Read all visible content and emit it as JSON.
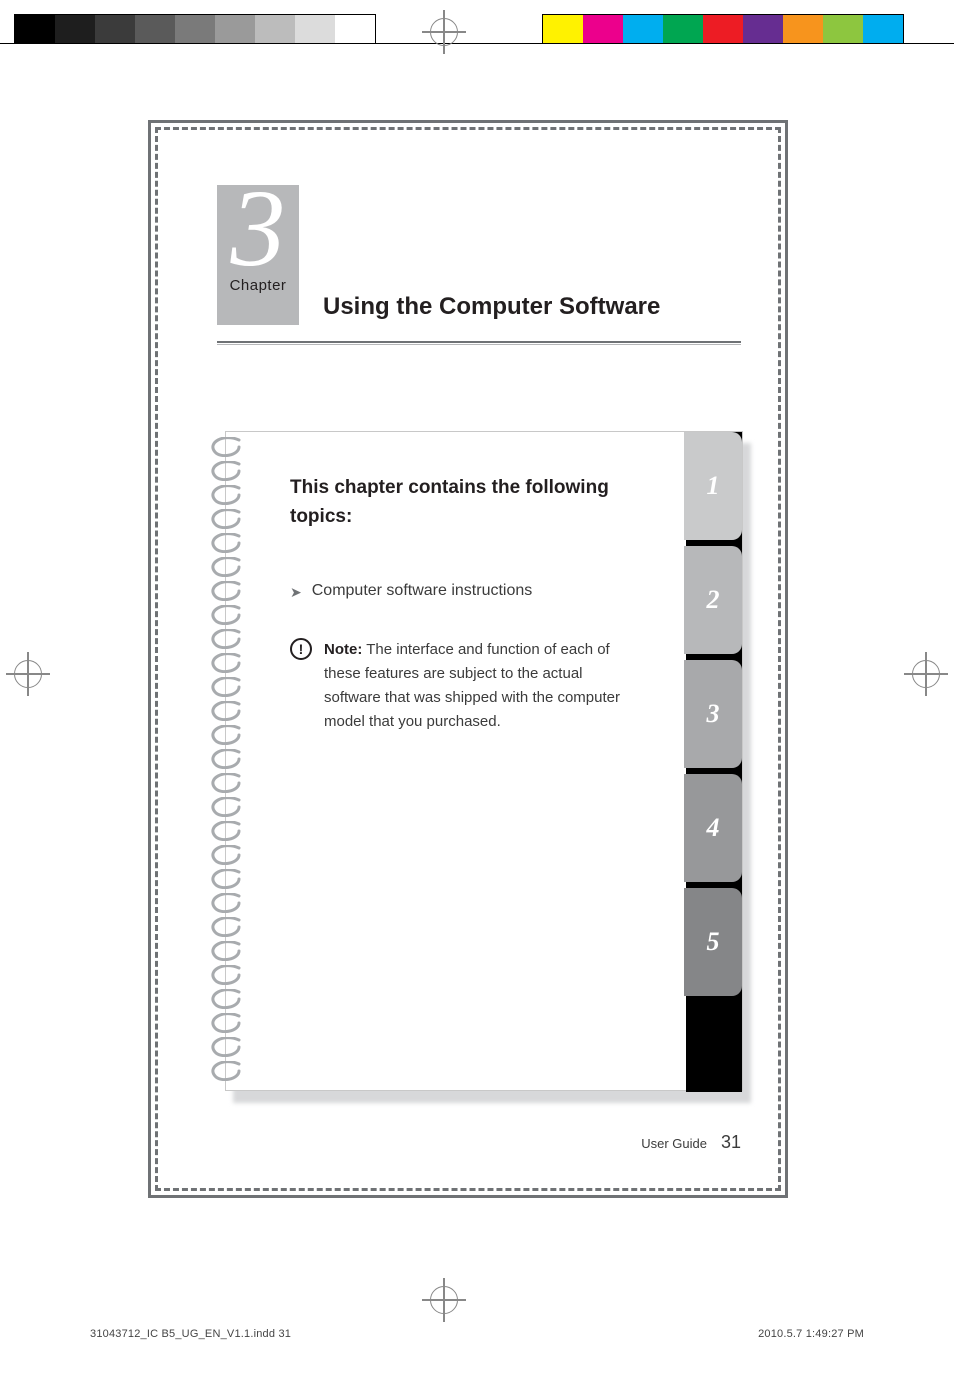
{
  "registration": {
    "left_swatches": [
      "#000000",
      "#1e1e1e",
      "#3b3b3b",
      "#5a5a5a",
      "#7a7a7a",
      "#9a9a9a",
      "#bcbcbc",
      "#dcdcdc",
      "#ffffff"
    ],
    "right_swatches": [
      "#fff200",
      "#ec008c",
      "#00aeef",
      "#00a651",
      "#ed1c24",
      "#662d91",
      "#f7941d",
      "#8dc63f",
      "#00adef"
    ]
  },
  "chapter": {
    "number": "3",
    "label": "Chapter",
    "title": "Using the Computer Software"
  },
  "topics": {
    "heading": "This chapter contains the following topics:",
    "items": [
      "Computer software instructions"
    ]
  },
  "note": {
    "label": "Note:",
    "text": "The interface and function of each of these features are subject to the actual software that was shipped with the computer model that you purchased."
  },
  "tabs": [
    "1",
    "2",
    "3",
    "4",
    "5"
  ],
  "footer": {
    "label": "User Guide",
    "page": "31"
  },
  "imprint": {
    "left": "31043712_IC B5_UG_EN_V1.1.indd   31",
    "right": "2010.5.7   1:49:27 PM"
  }
}
